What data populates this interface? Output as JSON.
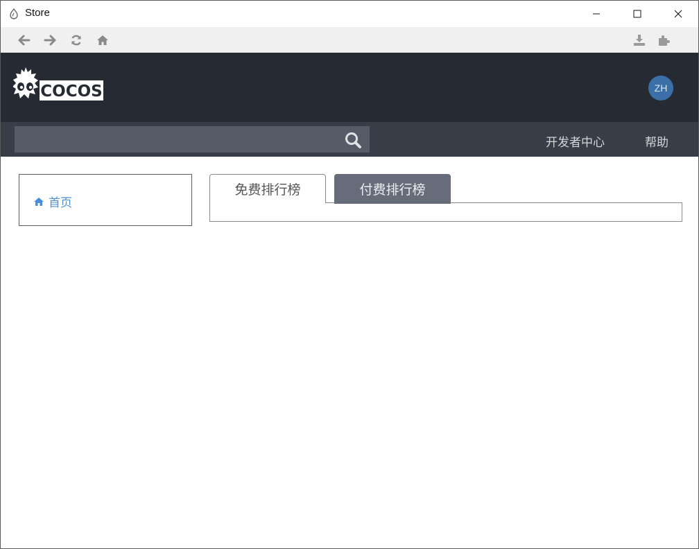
{
  "window": {
    "title": "Store"
  },
  "header": {
    "logo_text": "COCOS",
    "avatar_text": "ZH"
  },
  "search": {
    "placeholder": "",
    "value": ""
  },
  "top_nav": {
    "developer_center": "开发者中心",
    "help": "帮助"
  },
  "sidebar": {
    "home_label": "首页"
  },
  "tabs": [
    {
      "label": "免费排行榜",
      "active": true
    },
    {
      "label": "付费排行榜",
      "active": false
    }
  ],
  "colors": {
    "header_bg": "#262b33",
    "subbar_bg": "#373e48",
    "search_bg": "#555c68",
    "avatar_bg": "#3a6fa8",
    "link_blue": "#4a90d9",
    "tab_inactive_bg": "#666c7a"
  },
  "icons": {
    "nav": [
      "back-icon",
      "forward-icon",
      "refresh-icon",
      "home-icon"
    ],
    "tools": [
      "download-icon",
      "plugin-icon"
    ]
  }
}
